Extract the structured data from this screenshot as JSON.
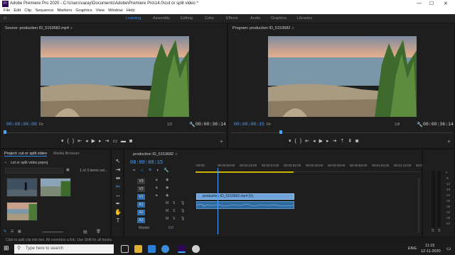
{
  "window_title": "Adobe Premiere Pro 2020 - C:\\Users\\varay\\Documents\\Adobe\\Premiere Pro\\14.0\\cut or split video *",
  "window_controls": [
    "—",
    "☐",
    "✕"
  ],
  "menu": [
    "File",
    "Edit",
    "Clip",
    "Sequence",
    "Markers",
    "Graphics",
    "View",
    "Window",
    "Help"
  ],
  "workspaces": [
    "Learning",
    "Assembly",
    "Editing",
    "Color",
    "Effects",
    "Audio",
    "Graphics",
    "Libraries"
  ],
  "active_workspace": "Learning",
  "source_monitor": {
    "title": "Source: production ID_5153682.mp4",
    "timecode": "00:00:00:00",
    "fit": "Fit",
    "resolution": "1/2",
    "duration": "00:00:36:14",
    "playhead_fraction": 0.0
  },
  "program_monitor": {
    "title": "Program: production ID_5153682",
    "timecode": "00:00:08:15",
    "fit": "Fit",
    "resolution": "1/8",
    "duration": "00:00:36:14",
    "playhead_fraction": 0.22
  },
  "project": {
    "tab_active": "Project: cut or split video",
    "tab_other": "Media Browser",
    "file": "cut or split video.prproj",
    "item_count": "1 of 3 items sel..."
  },
  "timeline": {
    "title": "production ID_5153682",
    "timecode": "00:00:08:15",
    "ruler_labels": [
      ":00:00",
      "00:00:08:00",
      "00:00:16:00",
      "00:00:24:00",
      "00:00:32:00",
      "00:00:40:00",
      "00:00:48:00",
      "00:00:56:00",
      "00:01:04:00",
      "00:01:12:00",
      "00:01:2"
    ],
    "video_tracks": [
      "V3",
      "V2",
      "V1"
    ],
    "audio_tracks": [
      "A1",
      "A2",
      "A3"
    ],
    "master_label": "Master",
    "master_value": "0.0",
    "clip_label": "production ID_5153682.mp4 [V]"
  },
  "meters": {
    "scale": [
      "0",
      "-6",
      "-12",
      "-18",
      "-24",
      "-30",
      "-36",
      "-42",
      "-48",
      "-54"
    ],
    "channels": [
      "S",
      "S"
    ]
  },
  "status_text": "Click to split clip into two. Alt overrides a link. Use Shift for all tracks.",
  "taskbar": {
    "search_placeholder": "Type here to search",
    "language": "ENG",
    "time": "11:15",
    "date": "12-11-2020"
  },
  "colors": {
    "accent": "#2d8ceb",
    "timecode": "#4aa3ff",
    "clip_video": "#6fa2d8",
    "clip_audio": "#2e6aa0"
  }
}
